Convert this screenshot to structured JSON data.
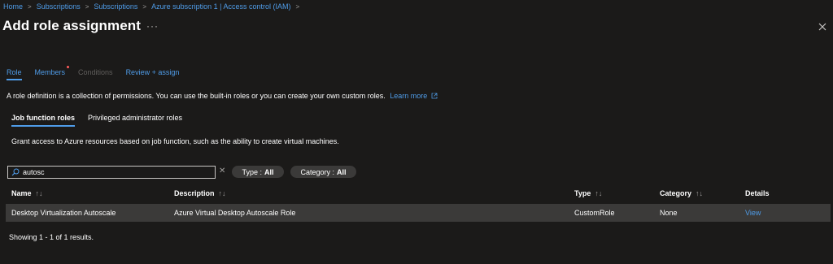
{
  "breadcrumb": [
    "Home",
    "Subscriptions",
    "Subscriptions",
    "Azure subscription 1 | Access control (IAM)"
  ],
  "page_title": "Add role assignment",
  "more_label": "···",
  "tabs": [
    {
      "label": "Role",
      "state": "active"
    },
    {
      "label": "Members",
      "state": "normal"
    },
    {
      "label": "Conditions",
      "state": "disabled"
    },
    {
      "label": "Review + assign",
      "state": "normal"
    }
  ],
  "description": {
    "text": "A role definition is a collection of permissions. You can use the built-in roles or you can create your own custom roles.",
    "link": "Learn more"
  },
  "subtabs": [
    "Job function roles",
    "Privileged administrator roles"
  ],
  "grant_text": "Grant access to Azure resources based on job function, such as the ability to create virtual machines.",
  "search": {
    "value": "autosc"
  },
  "filters": {
    "type": {
      "label": "Type :",
      "value": "All"
    },
    "category": {
      "label": "Category :",
      "value": "All"
    }
  },
  "table": {
    "columns": [
      "Name",
      "Description",
      "Type",
      "Category",
      "Details"
    ],
    "rows": [
      {
        "name": "Desktop Virtualization Autoscale",
        "description": "Azure Virtual Desktop Autoscale Role",
        "type": "CustomRole",
        "category": "None",
        "details": "View"
      }
    ]
  },
  "results_text": "Showing 1 - 1 of 1 results.",
  "colors": {
    "background": "#1b1a19",
    "accent": "#4f9ce8",
    "row_selected": "#3b3a39",
    "required": "#ff5a5a"
  }
}
